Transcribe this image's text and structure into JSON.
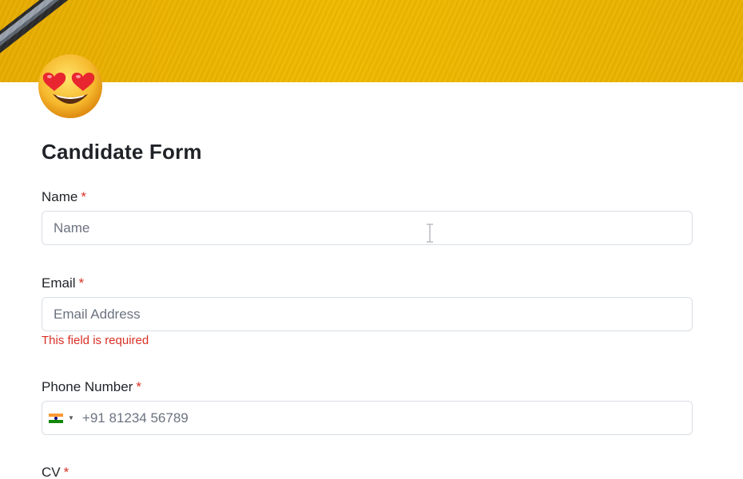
{
  "form": {
    "title": "Candidate Form",
    "required_marker": "*",
    "fields": {
      "name": {
        "label": "Name",
        "placeholder": "Name"
      },
      "email": {
        "label": "Email",
        "placeholder": "Email Address",
        "error": "This field is required"
      },
      "phone": {
        "label": "Phone Number",
        "placeholder": "+91 81234 56789",
        "country_flag": "india-flag-icon"
      },
      "cv": {
        "label": "CV"
      }
    }
  },
  "icons": {
    "header": "pen-icon",
    "avatar": "heart-eyes-emoji-icon",
    "cursor": "text-cursor-icon"
  },
  "colors": {
    "cover": "#f0ba00",
    "required": "#d93025",
    "error": "#d93025",
    "input_border": "#d9dde3",
    "placeholder": "#6b7280"
  }
}
